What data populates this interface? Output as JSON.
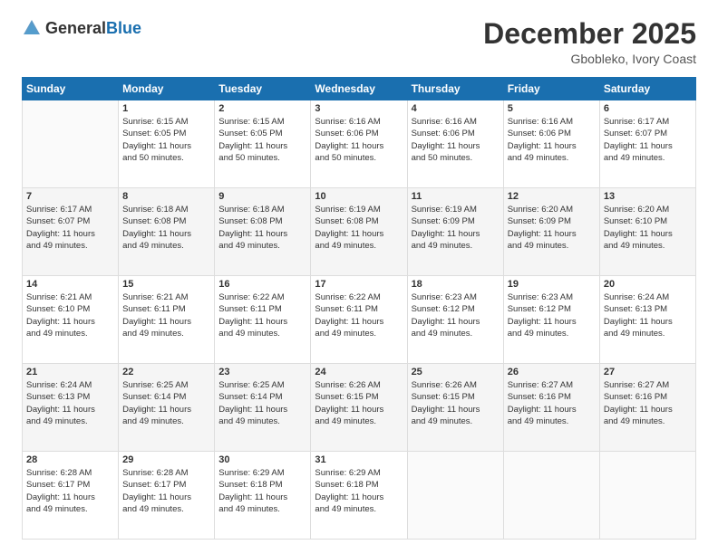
{
  "header": {
    "logo_general": "General",
    "logo_blue": "Blue",
    "month_title": "December 2025",
    "location": "Gbobleko, Ivory Coast"
  },
  "days_of_week": [
    "Sunday",
    "Monday",
    "Tuesday",
    "Wednesday",
    "Thursday",
    "Friday",
    "Saturday"
  ],
  "weeks": [
    [
      {
        "day": "",
        "info": ""
      },
      {
        "day": "1",
        "info": "Sunrise: 6:15 AM\nSunset: 6:05 PM\nDaylight: 11 hours\nand 50 minutes."
      },
      {
        "day": "2",
        "info": "Sunrise: 6:15 AM\nSunset: 6:05 PM\nDaylight: 11 hours\nand 50 minutes."
      },
      {
        "day": "3",
        "info": "Sunrise: 6:16 AM\nSunset: 6:06 PM\nDaylight: 11 hours\nand 50 minutes."
      },
      {
        "day": "4",
        "info": "Sunrise: 6:16 AM\nSunset: 6:06 PM\nDaylight: 11 hours\nand 50 minutes."
      },
      {
        "day": "5",
        "info": "Sunrise: 6:16 AM\nSunset: 6:06 PM\nDaylight: 11 hours\nand 49 minutes."
      },
      {
        "day": "6",
        "info": "Sunrise: 6:17 AM\nSunset: 6:07 PM\nDaylight: 11 hours\nand 49 minutes."
      }
    ],
    [
      {
        "day": "7",
        "info": "Sunrise: 6:17 AM\nSunset: 6:07 PM\nDaylight: 11 hours\nand 49 minutes."
      },
      {
        "day": "8",
        "info": "Sunrise: 6:18 AM\nSunset: 6:08 PM\nDaylight: 11 hours\nand 49 minutes."
      },
      {
        "day": "9",
        "info": "Sunrise: 6:18 AM\nSunset: 6:08 PM\nDaylight: 11 hours\nand 49 minutes."
      },
      {
        "day": "10",
        "info": "Sunrise: 6:19 AM\nSunset: 6:08 PM\nDaylight: 11 hours\nand 49 minutes."
      },
      {
        "day": "11",
        "info": "Sunrise: 6:19 AM\nSunset: 6:09 PM\nDaylight: 11 hours\nand 49 minutes."
      },
      {
        "day": "12",
        "info": "Sunrise: 6:20 AM\nSunset: 6:09 PM\nDaylight: 11 hours\nand 49 minutes."
      },
      {
        "day": "13",
        "info": "Sunrise: 6:20 AM\nSunset: 6:10 PM\nDaylight: 11 hours\nand 49 minutes."
      }
    ],
    [
      {
        "day": "14",
        "info": "Sunrise: 6:21 AM\nSunset: 6:10 PM\nDaylight: 11 hours\nand 49 minutes."
      },
      {
        "day": "15",
        "info": "Sunrise: 6:21 AM\nSunset: 6:11 PM\nDaylight: 11 hours\nand 49 minutes."
      },
      {
        "day": "16",
        "info": "Sunrise: 6:22 AM\nSunset: 6:11 PM\nDaylight: 11 hours\nand 49 minutes."
      },
      {
        "day": "17",
        "info": "Sunrise: 6:22 AM\nSunset: 6:11 PM\nDaylight: 11 hours\nand 49 minutes."
      },
      {
        "day": "18",
        "info": "Sunrise: 6:23 AM\nSunset: 6:12 PM\nDaylight: 11 hours\nand 49 minutes."
      },
      {
        "day": "19",
        "info": "Sunrise: 6:23 AM\nSunset: 6:12 PM\nDaylight: 11 hours\nand 49 minutes."
      },
      {
        "day": "20",
        "info": "Sunrise: 6:24 AM\nSunset: 6:13 PM\nDaylight: 11 hours\nand 49 minutes."
      }
    ],
    [
      {
        "day": "21",
        "info": "Sunrise: 6:24 AM\nSunset: 6:13 PM\nDaylight: 11 hours\nand 49 minutes."
      },
      {
        "day": "22",
        "info": "Sunrise: 6:25 AM\nSunset: 6:14 PM\nDaylight: 11 hours\nand 49 minutes."
      },
      {
        "day": "23",
        "info": "Sunrise: 6:25 AM\nSunset: 6:14 PM\nDaylight: 11 hours\nand 49 minutes."
      },
      {
        "day": "24",
        "info": "Sunrise: 6:26 AM\nSunset: 6:15 PM\nDaylight: 11 hours\nand 49 minutes."
      },
      {
        "day": "25",
        "info": "Sunrise: 6:26 AM\nSunset: 6:15 PM\nDaylight: 11 hours\nand 49 minutes."
      },
      {
        "day": "26",
        "info": "Sunrise: 6:27 AM\nSunset: 6:16 PM\nDaylight: 11 hours\nand 49 minutes."
      },
      {
        "day": "27",
        "info": "Sunrise: 6:27 AM\nSunset: 6:16 PM\nDaylight: 11 hours\nand 49 minutes."
      }
    ],
    [
      {
        "day": "28",
        "info": "Sunrise: 6:28 AM\nSunset: 6:17 PM\nDaylight: 11 hours\nand 49 minutes."
      },
      {
        "day": "29",
        "info": "Sunrise: 6:28 AM\nSunset: 6:17 PM\nDaylight: 11 hours\nand 49 minutes."
      },
      {
        "day": "30",
        "info": "Sunrise: 6:29 AM\nSunset: 6:18 PM\nDaylight: 11 hours\nand 49 minutes."
      },
      {
        "day": "31",
        "info": "Sunrise: 6:29 AM\nSunset: 6:18 PM\nDaylight: 11 hours\nand 49 minutes."
      },
      {
        "day": "",
        "info": ""
      },
      {
        "day": "",
        "info": ""
      },
      {
        "day": "",
        "info": ""
      }
    ]
  ]
}
